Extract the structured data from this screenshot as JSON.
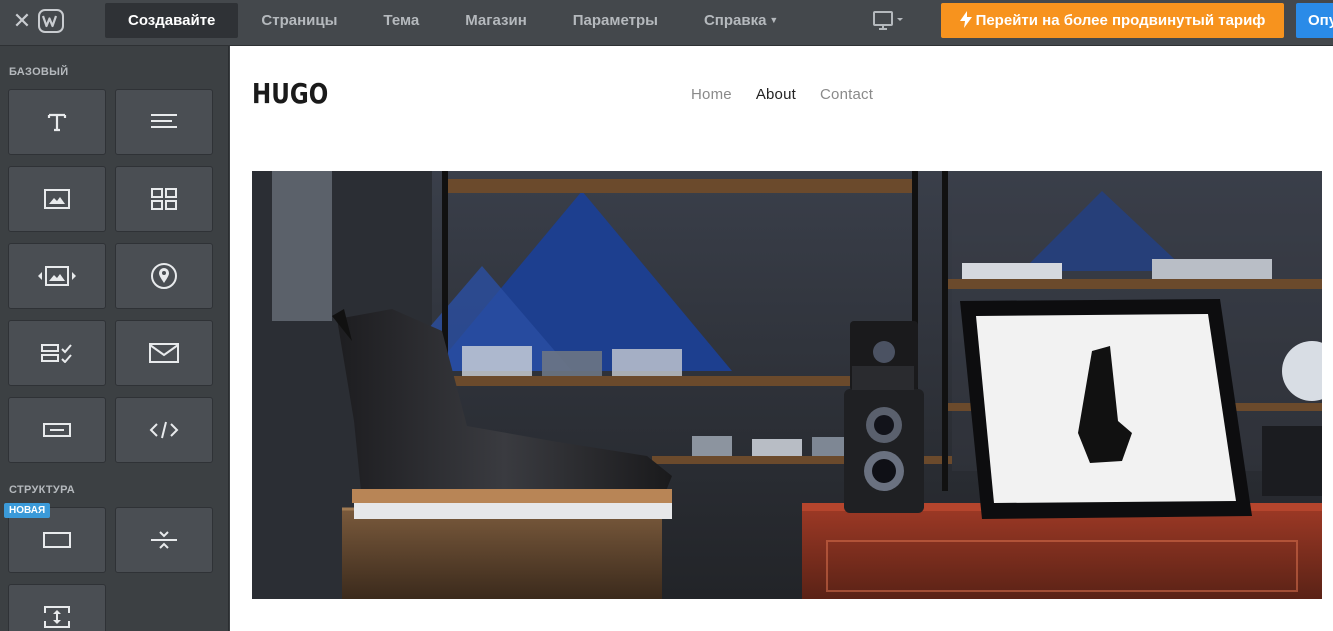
{
  "topbar": {
    "close_icon": "close-icon",
    "logo_icon": "weebly-logo-icon",
    "tabs": [
      {
        "label": "Создавайте",
        "active": true
      },
      {
        "label": "Страницы"
      },
      {
        "label": "Тема"
      },
      {
        "label": "Магазин"
      },
      {
        "label": "Параметры"
      },
      {
        "label": "Справка"
      }
    ],
    "device_icon": "desktop-monitor-icon",
    "upgrade_label": "Перейти на более продвинутый тариф",
    "upgrade_color": "#f7931e",
    "publish_label": "Опубликовать",
    "publish_color": "#2a8be8"
  },
  "sidebar": {
    "section_basic": "БАЗОВЫЙ",
    "section_structure": "СТРУКТУРА",
    "new_badge": "НОВАЯ",
    "basic_elements": [
      {
        "icon": "title-icon"
      },
      {
        "icon": "text-icon"
      },
      {
        "icon": "image-icon"
      },
      {
        "icon": "gallery-icon"
      },
      {
        "icon": "slideshow-icon"
      },
      {
        "icon": "map-icon"
      },
      {
        "icon": "contact-form-icon"
      },
      {
        "icon": "newsletter-icon"
      },
      {
        "icon": "button-icon"
      },
      {
        "icon": "embed-code-icon"
      }
    ],
    "structure_elements": [
      {
        "icon": "section-icon"
      },
      {
        "icon": "divider-icon"
      },
      {
        "icon": "spacer-icon"
      }
    ]
  },
  "site": {
    "logo": "HUGO",
    "nav": [
      "Home",
      "About",
      "Contact"
    ],
    "current_nav": "About",
    "hero_image": "boot-and-camera-shop-photo"
  }
}
